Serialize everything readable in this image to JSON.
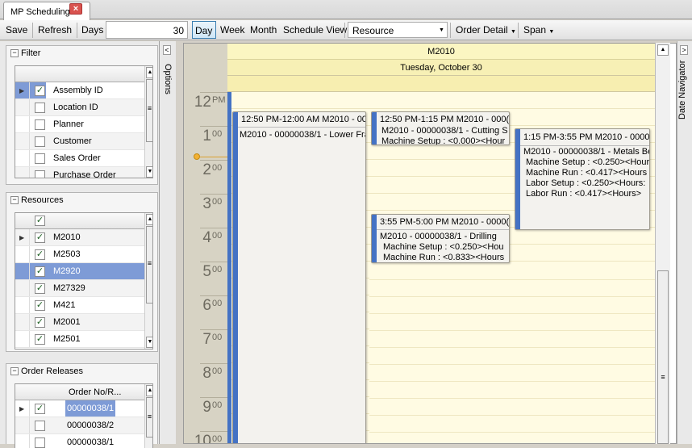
{
  "window": {
    "tab_title": "MP Scheduling",
    "close_glyph": "×"
  },
  "toolbar": {
    "save": "Save",
    "refresh": "Refresh",
    "days_label": "Days",
    "days_value": "30",
    "day": "Day",
    "week": "Week",
    "month": "Month",
    "schedule_view": "Schedule View",
    "group_by": "Resource",
    "order_detail": "Order Detail",
    "span": "Span"
  },
  "side_labels": {
    "options": "Options",
    "date_navigator": "Date Navigator"
  },
  "filter": {
    "title": "Filter",
    "items": [
      "Assembly ID",
      "Location ID",
      "Planner",
      "Customer",
      "Sales Order",
      "Purchase Order"
    ]
  },
  "resources": {
    "title": "Resources",
    "items": [
      "M2010",
      "M2503",
      "M2920",
      "M27329",
      "M421",
      "M2001",
      "M2501"
    ]
  },
  "order_releases": {
    "title": "Order Releases",
    "column": "Order No/R...",
    "items": [
      "00000038/1",
      "00000038/2",
      "00000038/1"
    ]
  },
  "calendar": {
    "resource": "M2010",
    "date": "Tuesday, October 30",
    "hours": [
      {
        "h": "12",
        "s": "PM"
      },
      {
        "h": "1",
        "s": "00"
      },
      {
        "h": "2",
        "s": "00"
      },
      {
        "h": "3",
        "s": "00"
      },
      {
        "h": "4",
        "s": "00"
      },
      {
        "h": "5",
        "s": "00"
      },
      {
        "h": "6",
        "s": "00"
      },
      {
        "h": "7",
        "s": "00"
      },
      {
        "h": "8",
        "s": "00"
      },
      {
        "h": "9",
        "s": "00"
      },
      {
        "h": "10",
        "s": "00"
      }
    ]
  },
  "appointments": [
    {
      "title": "12:50 PM-12:00 AM M2010 - 000",
      "lines": [
        "M2010 - 00000038/1 - Lower Fra"
      ]
    },
    {
      "title": "12:50 PM-1:15 PM M2010 - 000(",
      "lines": [
        "M2010 - 00000038/1 - Cutting S",
        "Machine Setup : <0.000><Hour"
      ]
    },
    {
      "title": "1:15 PM-3:55 PM M2010 - 0000(",
      "lines": [
        "M2010 - 00000038/1 - Metals Be",
        "Machine Setup : <0.250><Hour",
        "Machine Run : <0.417><Hours",
        "Labor Setup : <0.250><Hours:",
        "Labor Run : <0.417><Hours>"
      ]
    },
    {
      "title": "3:55 PM-5:00 PM M2010 - 0000(",
      "lines": [
        "M2010 - 00000038/1 - Drilling",
        "Machine Setup : <0.250><Hou",
        "Machine Run : <0.833><Hours"
      ]
    }
  ],
  "icons": {
    "check": "✓",
    "row_arrow": "▶",
    "scroll_up": "▲",
    "scroll_down": "▼",
    "grip": "≡",
    "collapse": "−",
    "chevron_left": "<",
    "chevron_right": ">"
  },
  "colors": {
    "accent": "#4472c4",
    "selection": "#7e9bd6",
    "calendar_bg": "#fffbe3"
  }
}
